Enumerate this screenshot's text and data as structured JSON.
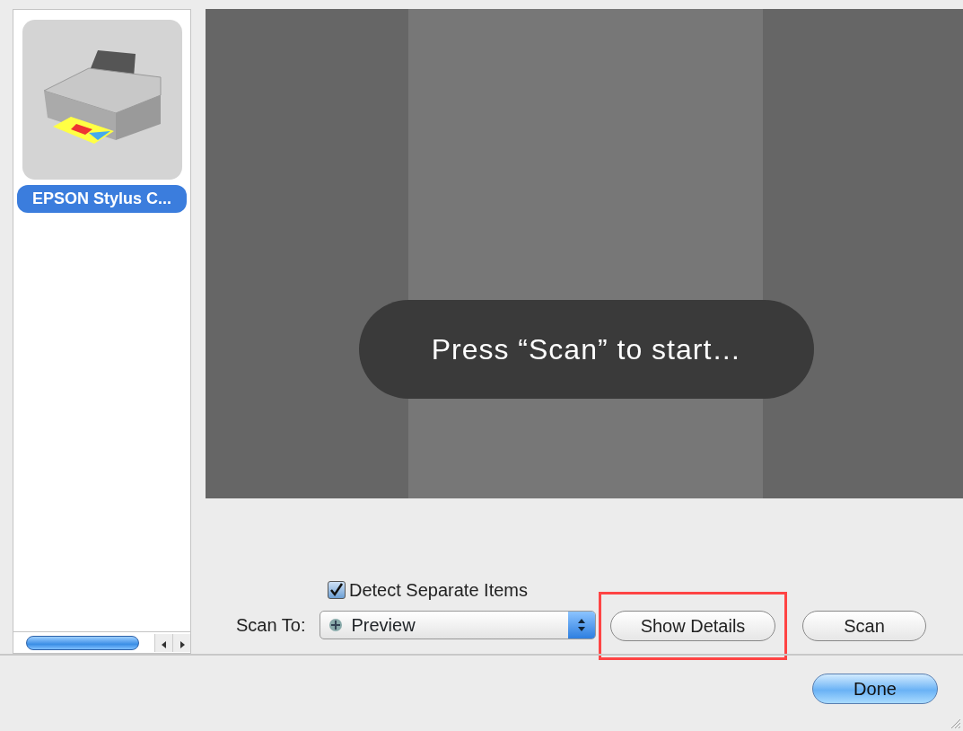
{
  "devices": [
    {
      "name": "EPSON Stylus C...",
      "selected": true
    }
  ],
  "preview": {
    "message": "Press “Scan” to start…"
  },
  "detect_separate_items": {
    "label": "Detect Separate Items",
    "checked": true
  },
  "scan_to": {
    "label": "Scan To:",
    "value": "Preview"
  },
  "actions": [
    {
      "label": "Show Details",
      "highlighted": true
    },
    {
      "label": "Scan",
      "highlighted": false
    }
  ],
  "done_button": {
    "label": "Done"
  }
}
